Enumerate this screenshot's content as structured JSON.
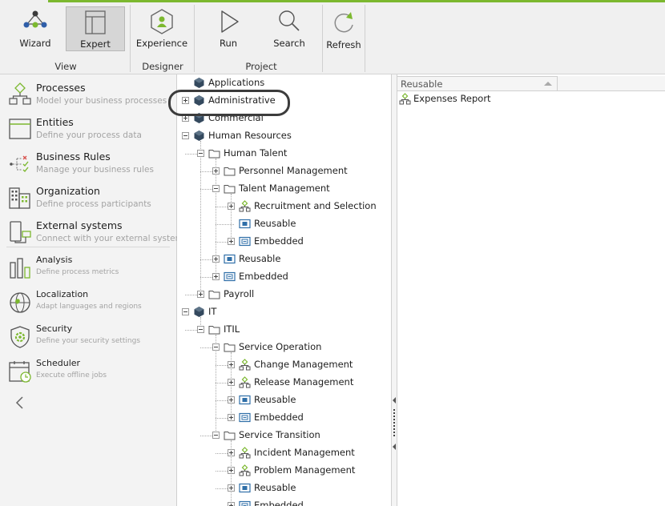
{
  "ribbon": {
    "buttons": {
      "wizard": "Wizard",
      "expert": "Expert",
      "experience": "Experience",
      "run": "Run",
      "search": "Search",
      "refresh": "Refresh"
    },
    "groups": {
      "view": "View",
      "designer": "Designer",
      "project": "Project"
    },
    "active_button": "Expert",
    "accent_color": "#7cb82f"
  },
  "leftnav": {
    "items": [
      {
        "title": "Processes",
        "subtitle": "Model your business processes",
        "icon": "processes-icon"
      },
      {
        "title": "Entities",
        "subtitle": "Define your process data",
        "icon": "entities-icon"
      },
      {
        "title": "Business Rules",
        "subtitle": "Manage your business rules",
        "icon": "business-rules-icon"
      },
      {
        "title": "Organization",
        "subtitle": "Define process participants",
        "icon": "organization-icon"
      },
      {
        "title": "External systems",
        "subtitle": "Connect with your external systems",
        "icon": "external-systems-icon"
      },
      {
        "title": "Analysis",
        "subtitle": "Define process metrics",
        "icon": "analysis-icon"
      },
      {
        "title": "Localization",
        "subtitle": "Adapt languages and regions",
        "icon": "localization-icon"
      },
      {
        "title": "Security",
        "subtitle": "Define your security settings",
        "icon": "security-icon"
      },
      {
        "title": "Scheduler",
        "subtitle": "Execute offline jobs",
        "icon": "scheduler-icon"
      }
    ],
    "collapse_icon": "chevron-left-icon"
  },
  "tree": {
    "nodes": [
      {
        "label": "Applications",
        "level": 0,
        "icon": "cube",
        "expander": "none",
        "highlighted": false
      },
      {
        "label": "Administrative",
        "level": 0,
        "icon": "cube",
        "expander": "plus",
        "highlighted": true
      },
      {
        "label": "Commercial",
        "level": 0,
        "icon": "cube",
        "expander": "plus",
        "highlighted": false
      },
      {
        "label": "Human Resources",
        "level": 0,
        "icon": "cube",
        "expander": "minus",
        "highlighted": false
      },
      {
        "label": "Human Talent",
        "level": 1,
        "icon": "folder",
        "expander": "minus",
        "highlighted": false
      },
      {
        "label": "Personnel Management",
        "level": 2,
        "icon": "folder",
        "expander": "plus",
        "highlighted": false
      },
      {
        "label": "Talent Management",
        "level": 2,
        "icon": "folder",
        "expander": "minus",
        "highlighted": false
      },
      {
        "label": "Recruitment and Selection",
        "level": 3,
        "icon": "process",
        "expander": "plus",
        "highlighted": false
      },
      {
        "label": "Reusable",
        "level": 3,
        "icon": "reusable",
        "expander": "none",
        "highlighted": false
      },
      {
        "label": "Embedded",
        "level": 3,
        "icon": "embedded",
        "expander": "plus",
        "highlighted": false
      },
      {
        "label": "Reusable",
        "level": 2,
        "icon": "reusable",
        "expander": "plus",
        "highlighted": false
      },
      {
        "label": "Embedded",
        "level": 2,
        "icon": "embedded",
        "expander": "plus",
        "highlighted": false
      },
      {
        "label": "Payroll",
        "level": 1,
        "icon": "folder",
        "expander": "plus",
        "highlighted": false
      },
      {
        "label": "IT",
        "level": 0,
        "icon": "cube",
        "expander": "minus",
        "highlighted": false
      },
      {
        "label": "ITIL",
        "level": 1,
        "icon": "folder",
        "expander": "minus",
        "highlighted": false
      },
      {
        "label": "Service Operation",
        "level": 2,
        "icon": "folder",
        "expander": "minus",
        "highlighted": false
      },
      {
        "label": "Change Management",
        "level": 3,
        "icon": "process",
        "expander": "plus",
        "highlighted": false
      },
      {
        "label": "Release Management",
        "level": 3,
        "icon": "process",
        "expander": "plus",
        "highlighted": false
      },
      {
        "label": "Reusable",
        "level": 3,
        "icon": "reusable",
        "expander": "plus",
        "highlighted": false
      },
      {
        "label": "Embedded",
        "level": 3,
        "icon": "embedded",
        "expander": "plus",
        "highlighted": false
      },
      {
        "label": "Service Transition",
        "level": 2,
        "icon": "folder",
        "expander": "minus",
        "highlighted": false
      },
      {
        "label": "Incident Management",
        "level": 3,
        "icon": "process",
        "expander": "plus",
        "highlighted": false
      },
      {
        "label": "Problem Management",
        "level": 3,
        "icon": "process",
        "expander": "plus",
        "highlighted": false
      },
      {
        "label": "Reusable",
        "level": 3,
        "icon": "reusable",
        "expander": "plus",
        "highlighted": false
      },
      {
        "label": "Embedded",
        "level": 3,
        "icon": "embedded",
        "expander": "plus",
        "highlighted": false
      }
    ]
  },
  "list": {
    "column_header": "Reusable",
    "sort_icon": "sort-ascending-icon",
    "items": [
      {
        "label": "Expenses Report",
        "icon": "process-icon"
      }
    ]
  }
}
